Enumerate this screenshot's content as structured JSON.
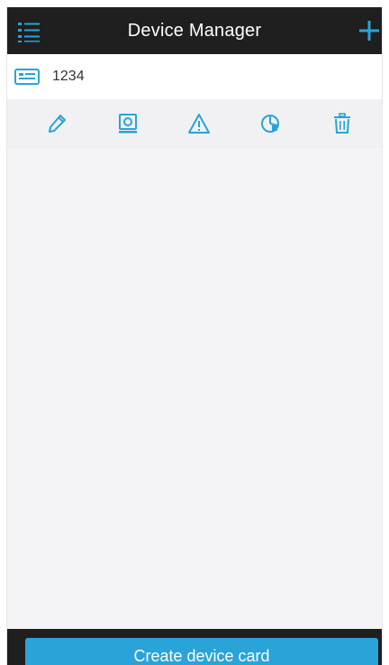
{
  "header": {
    "title": "Device Manager",
    "menu_icon": "list-icon",
    "add_icon": "plus-icon"
  },
  "device": {
    "name": "1234",
    "icon": "device-card-icon"
  },
  "actions": [
    {
      "icon": "pencil-icon"
    },
    {
      "icon": "camera-icon"
    },
    {
      "icon": "warning-icon"
    },
    {
      "icon": "pie-chart-icon"
    },
    {
      "icon": "trash-icon"
    }
  ],
  "footer": {
    "create_label": "Create device card"
  },
  "colors": {
    "accent": "#2aa3d8",
    "topbar": "#1f1f1f",
    "background": "#f4f4f6"
  }
}
